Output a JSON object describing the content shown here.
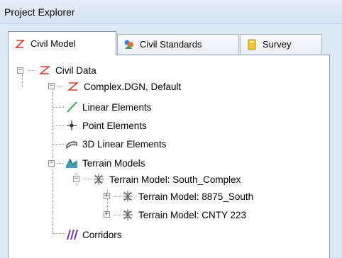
{
  "window": {
    "title": "Project Explorer"
  },
  "tabs": [
    {
      "label": "Civil Model",
      "icon": "civil-model-z-icon",
      "active": true
    },
    {
      "label": "Civil Standards",
      "icon": "civil-standards-icon",
      "active": false
    },
    {
      "label": "Survey",
      "icon": "survey-icon",
      "active": false
    }
  ],
  "tree": {
    "civil_data": {
      "label": "Civil Data",
      "expander": "−"
    },
    "complex": {
      "label": "Complex.DGN, Default",
      "expander": "−"
    },
    "linear": {
      "label": "Linear Elements"
    },
    "point": {
      "label": "Point Elements"
    },
    "linear3d": {
      "label": "3D Linear Elements"
    },
    "terrain_models": {
      "label": "Terrain Models",
      "expander": "−"
    },
    "tm_south_complex": {
      "label": "Terrain Model: South_Complex",
      "expander": "−"
    },
    "tm_8875": {
      "label": "Terrain Model: 8875_South",
      "expander": "+"
    },
    "tm_cnty": {
      "label": "Terrain Model: CNTY 223",
      "expander": "+"
    },
    "corridors": {
      "label": "Corridors"
    }
  },
  "colors": {
    "civil_z_red": "#d4382c",
    "linear_green": "#2e9e3a",
    "terrain_purple": "#6b3fb0"
  }
}
